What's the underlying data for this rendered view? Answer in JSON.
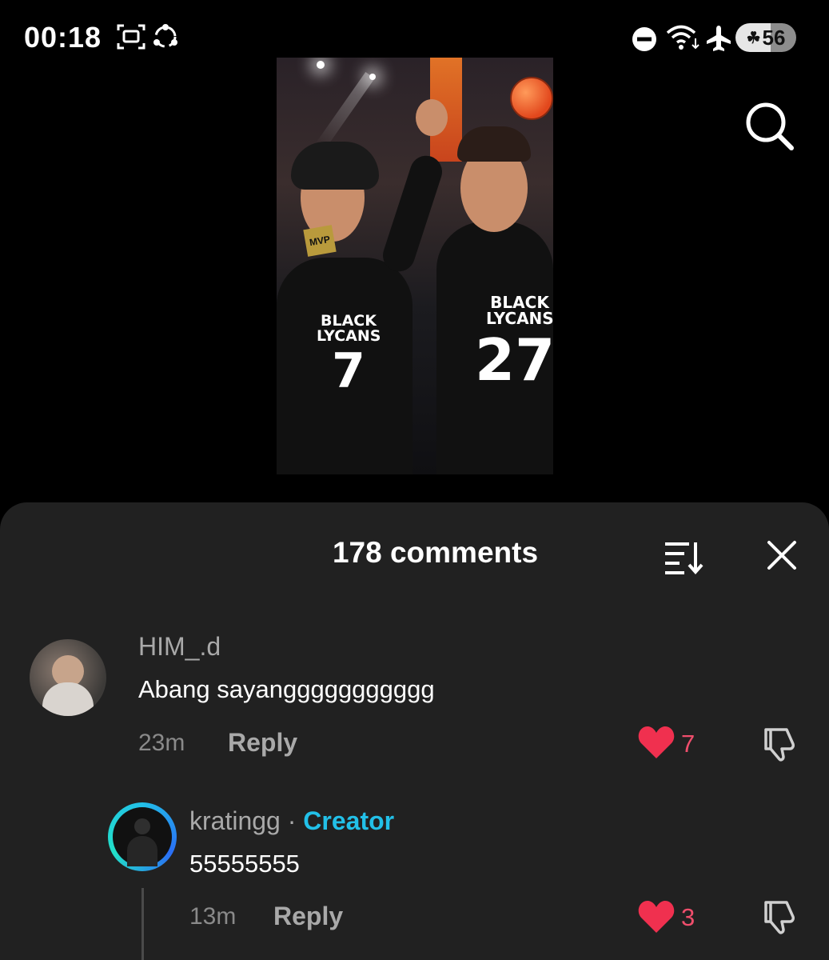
{
  "status_bar": {
    "time": "00:18",
    "battery": "56",
    "icons": [
      "screenshot-icon",
      "share-icon",
      "do-not-disturb-icon",
      "wifi-icon",
      "airplane-icon",
      "battery-icon"
    ]
  },
  "video": {
    "jersey_left_team": "BLACK\nLYCANS",
    "jersey_left_number": "7",
    "jersey_right_team": "BLACK\nLYCANS",
    "jersey_right_number": "27",
    "mvp_label": "MVP"
  },
  "comments_sheet": {
    "title": "178 comments",
    "comments": [
      {
        "username": "HIM_.d",
        "text": "Abang sayanggggggggggg",
        "time": "23m",
        "reply_label": "Reply",
        "likes": "7"
      },
      {
        "username": "kratingg",
        "separator": " · ",
        "badge": "Creator",
        "text": "55555555",
        "time": "13m",
        "reply_label": "Reply",
        "likes": "3"
      }
    ]
  },
  "colors": {
    "sheet_bg": "#212121",
    "like_red": "#f04e6c",
    "creator_blue": "#22c0e8"
  }
}
